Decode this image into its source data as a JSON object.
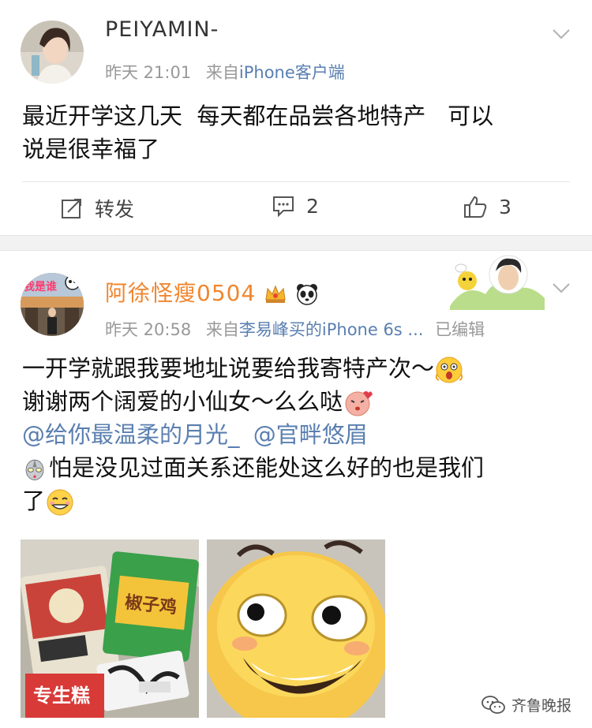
{
  "post1": {
    "username": "PEIYAMIN-",
    "time": "昨天 21:01",
    "source_prefix": "来自",
    "source": "iPhone客户端",
    "lines": [
      "最近开学这几天  每天都在品尝各地特产   可以",
      "说是很幸福了"
    ],
    "actions": {
      "repost_label": "转发",
      "comment_count": "2",
      "like_count": "3"
    }
  },
  "post2": {
    "username": "阿徐怪瘦0504",
    "avatar_text": "我是谁",
    "time": "昨天 20:58",
    "source_prefix": "来自",
    "source": "李易峰买的iPhone 6s ...",
    "edited": "已编辑",
    "lines": {
      "l1": "一开学就跟我要地址说要给我寄特产次～",
      "l2": "谢谢两个阔爱的小仙女～么么哒",
      "mention1": "@给你最温柔的月光_",
      "mention2": "@官畔悠眉",
      "l4": "怕是没见过面关系还能处这么好的也是我们",
      "l5": "了"
    },
    "photo1_texts": [
      "椒子鸡",
      "专生糕"
    ]
  },
  "watermark": "齐鲁晚报",
  "colors": {
    "username_orange": "#f0862f",
    "link_blue": "#5a7fb0",
    "meta_gray": "#999999"
  }
}
